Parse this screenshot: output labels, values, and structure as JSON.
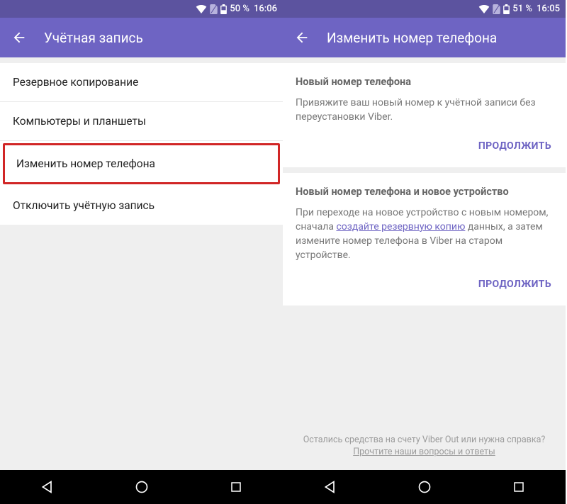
{
  "left": {
    "status": {
      "battery": "50 %",
      "time": "16:06"
    },
    "title": "Учётная запись",
    "items": [
      {
        "label": "Резервное копирование"
      },
      {
        "label": "Компьютеры и планшеты"
      },
      {
        "label": "Изменить номер телефона"
      },
      {
        "label": "Отключить учётную запись"
      }
    ]
  },
  "right": {
    "status": {
      "battery": "51 %",
      "time": "16:05"
    },
    "title": "Изменить номер телефона",
    "section1": {
      "title": "Новый номер телефона",
      "text": "Привяжите ваш новый номер к учётной записи без переустановки Viber.",
      "action": "ПРОДОЛЖИТЬ"
    },
    "section2": {
      "title": "Новый номер телефона и новое устройство",
      "text_before": "При переходе на новое устройство с новым номером, сначала ",
      "link": "создайте резервную копию",
      "text_after": " данных, а затем измените номер телефона в Viber на старом устройстве.",
      "action": "ПРОДОЛЖИТЬ"
    },
    "footer": {
      "line1": "Остались средства на счету Viber Out или нужна справка?",
      "line2": "Прочтите наши вопросы и ответы"
    }
  }
}
